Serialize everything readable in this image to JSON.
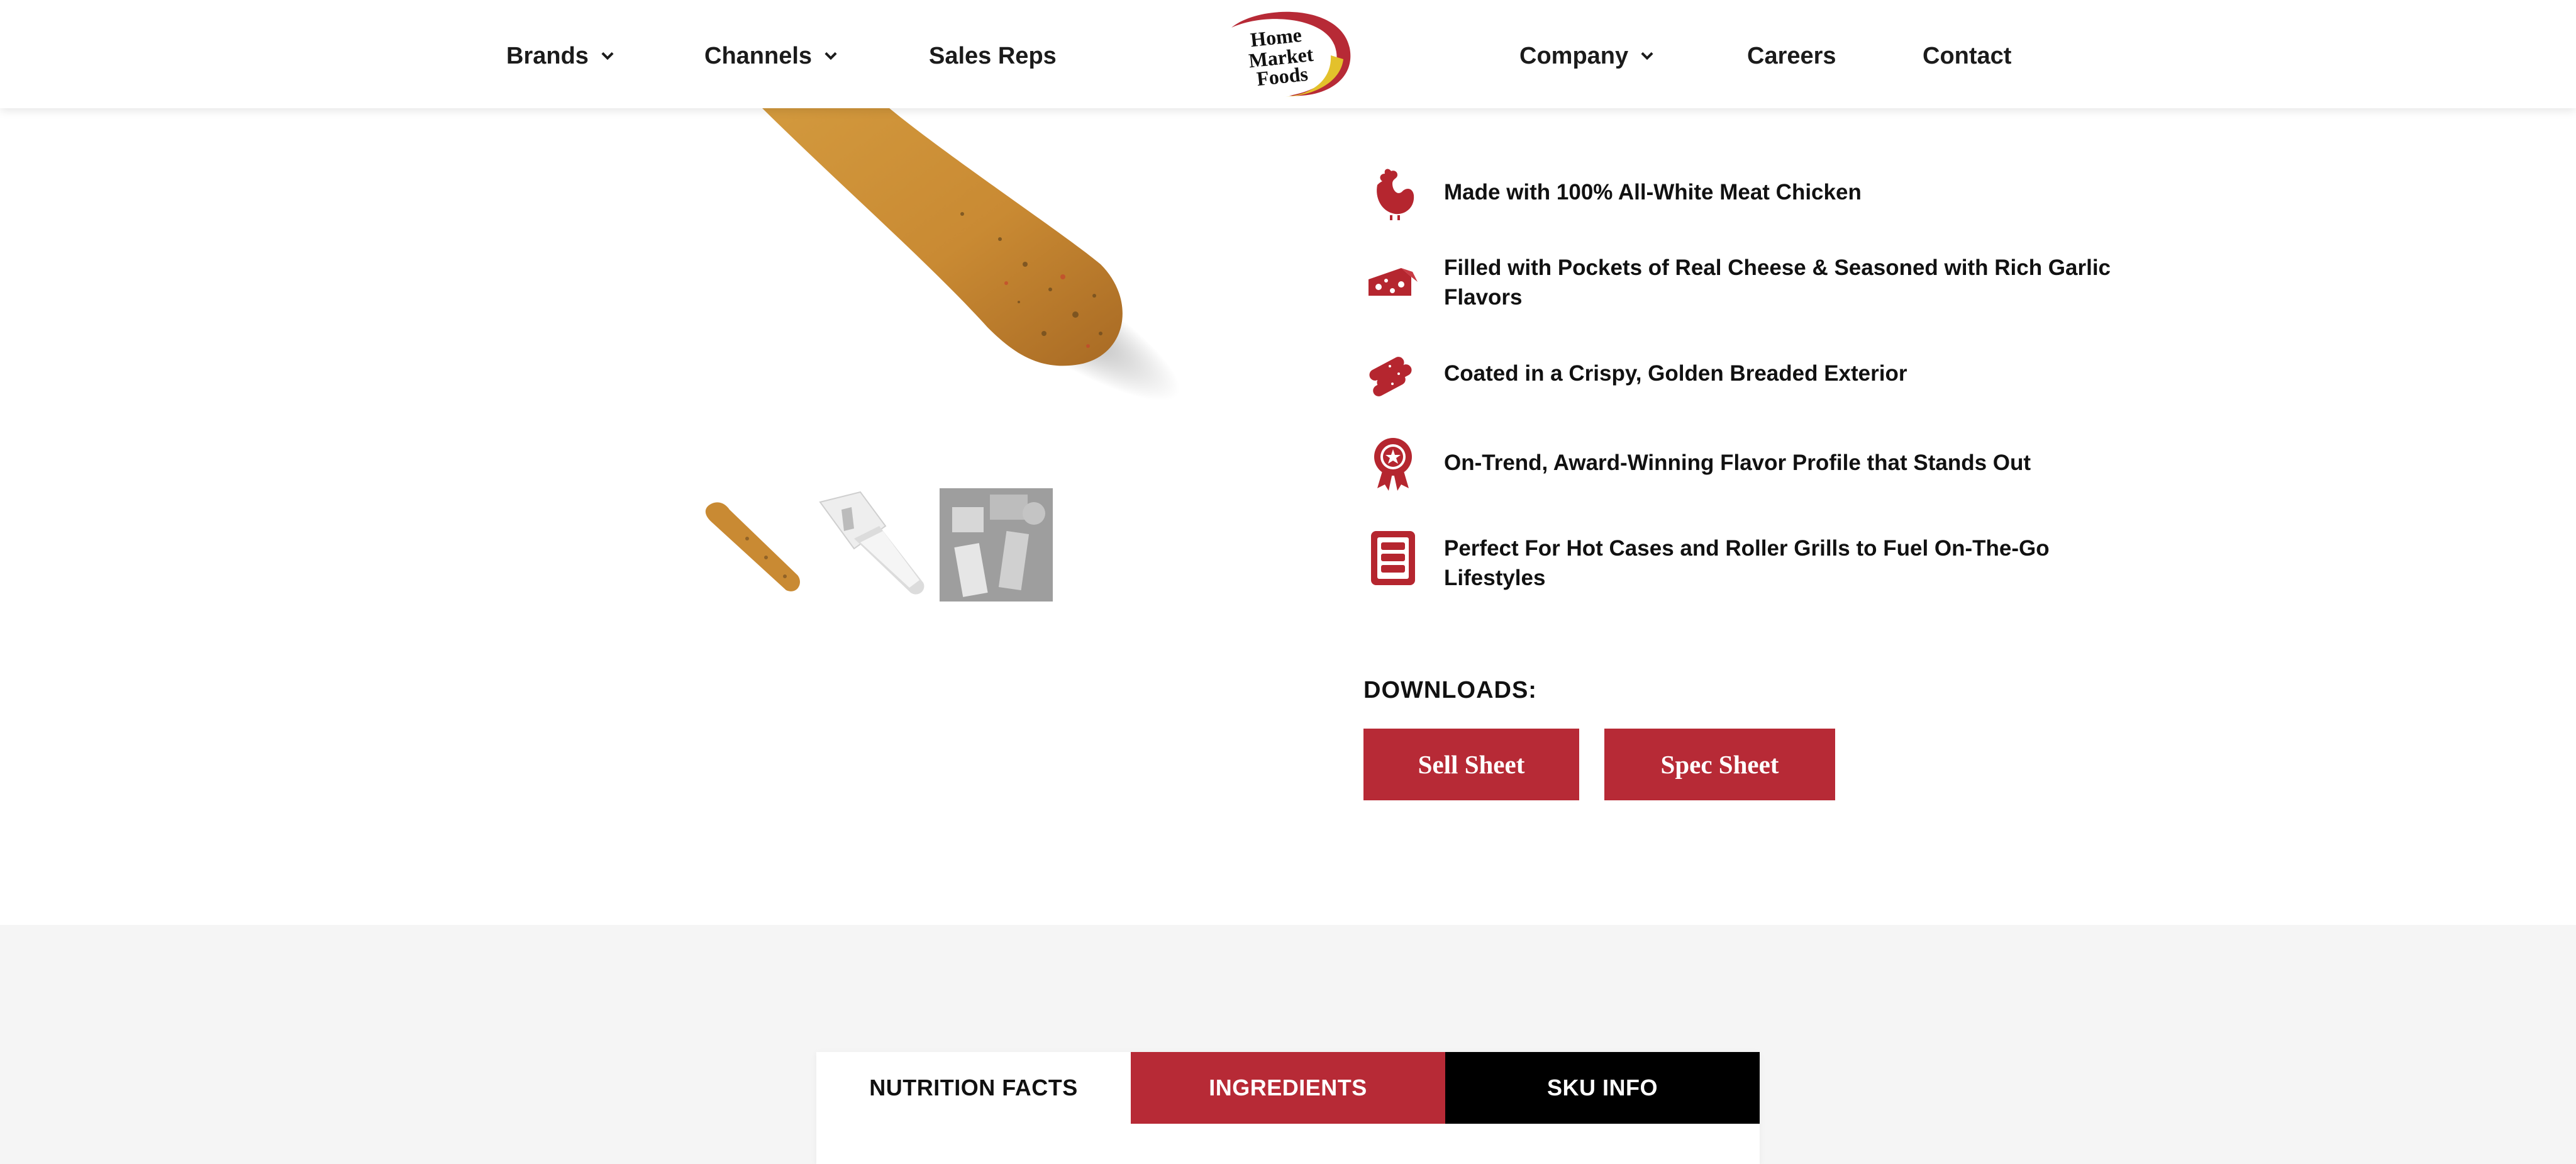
{
  "header": {
    "nav_left": [
      {
        "label": "Brands",
        "has_dropdown": true
      },
      {
        "label": "Channels",
        "has_dropdown": true
      },
      {
        "label": "Sales Reps",
        "has_dropdown": false
      }
    ],
    "logo": {
      "line1": "Home",
      "line2": "Market",
      "line3": "Foods"
    },
    "nav_right": [
      {
        "label": "Company",
        "has_dropdown": true
      },
      {
        "label": "Careers",
        "has_dropdown": false
      },
      {
        "label": "Contact",
        "has_dropdown": false
      }
    ]
  },
  "product": {
    "thumbnails": [
      {
        "icon": "breaded-stick-image"
      },
      {
        "icon": "packaged-stick-image"
      },
      {
        "icon": "serving-image"
      }
    ]
  },
  "features": [
    {
      "icon": "chicken-icon",
      "text": "Made with 100% All-White Meat Chicken"
    },
    {
      "icon": "cheese-icon",
      "text": "Filled with Pockets of Real Cheese & Seasoned with Rich Garlic Flavors"
    },
    {
      "icon": "breaded-sticks-icon",
      "text": "Coated in a Crispy, Golden Breaded Exterior"
    },
    {
      "icon": "award-ribbon-icon",
      "text": "On-Trend, Award-Winning Flavor Profile that Stands Out"
    },
    {
      "icon": "hot-case-icon",
      "text": "Perfect For Hot Cases and Roller Grills to Fuel On-The-Go Lifestyles"
    }
  ],
  "downloads": {
    "label": "DOWNLOADS:",
    "buttons": [
      "Sell Sheet",
      "Spec Sheet"
    ]
  },
  "tabs": [
    {
      "label": "NUTRITION FACTS",
      "state": "active"
    },
    {
      "label": "INGREDIENTS",
      "state": "inactive"
    },
    {
      "label": "SKU INFO",
      "state": "inactive"
    }
  ],
  "colors": {
    "brand_red": "#b72a36",
    "icon_red": "#b5262f",
    "dark_tab": "#000000",
    "lower_background": "#f5f5f5"
  }
}
